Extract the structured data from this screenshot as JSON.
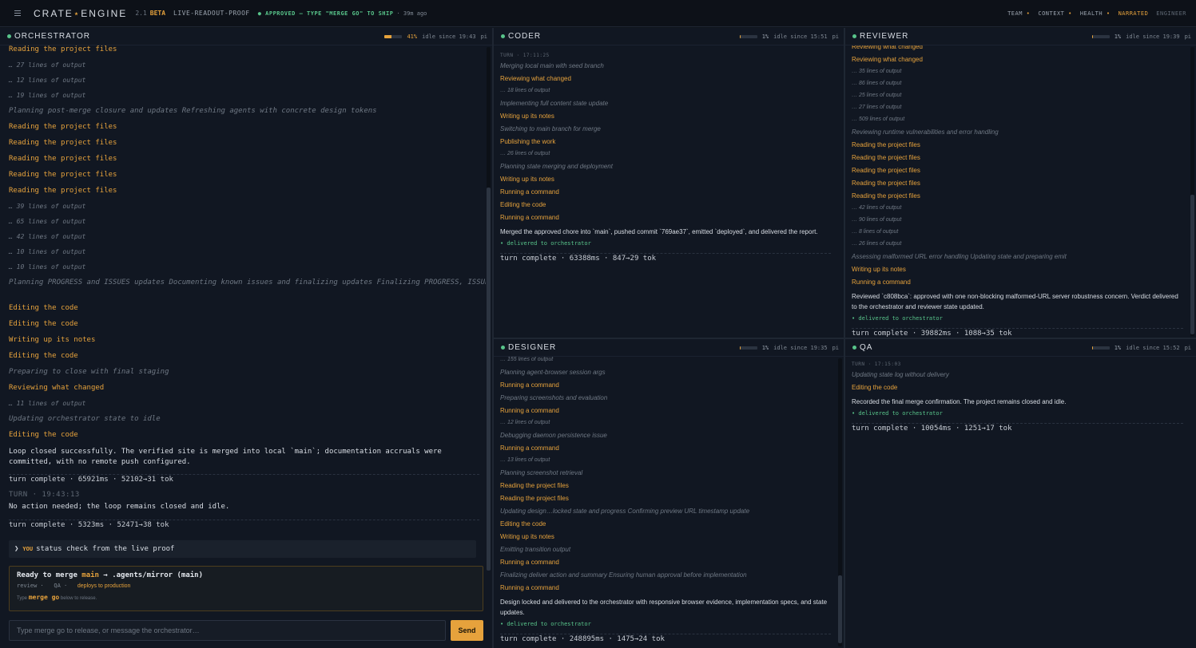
{
  "topbar": {
    "brand_left": "CRATE",
    "brand_star": "⋆",
    "brand_right": "ENGINE",
    "version": "2.1",
    "beta": "BETA",
    "proof": "LIVE-READOUT-PROOF",
    "approved": "● APPROVED — TYPE \"MERGE GO\" TO SHIP",
    "ago": "· 39m ago",
    "nav": {
      "team": "TEAM",
      "context": "CONTEXT",
      "health": "HEALTH",
      "narrated": "NARRATED",
      "engineer": "ENGINEER",
      "dot": "•"
    }
  },
  "panes": {
    "orchestrator": {
      "title": "ORCHESTRATOR",
      "pct": "41%",
      "progress": 0.41,
      "idle": "idle since 19:43",
      "tag": "pi",
      "lines": [
        {
          "t": "act",
          "text": "Reading the project files"
        },
        {
          "t": "out",
          "text": "… 27 lines of output"
        },
        {
          "t": "out",
          "text": "… 12 lines of output"
        },
        {
          "t": "out",
          "text": "… 19 lines of output"
        },
        {
          "t": "think",
          "text": "Planning post-merge closure and updates Refreshing agents with concrete design tokens"
        },
        {
          "t": "act",
          "text": "Reading the project files"
        },
        {
          "t": "act",
          "text": "Reading the project files"
        },
        {
          "t": "act",
          "text": "Reading the project files"
        },
        {
          "t": "act",
          "text": "Reading the project files"
        },
        {
          "t": "act",
          "text": "Reading the project files"
        },
        {
          "t": "out",
          "text": "… 39 lines of output"
        },
        {
          "t": "out",
          "text": "… 65 lines of output"
        },
        {
          "t": "out",
          "text": "… 42 lines of output"
        },
        {
          "t": "out",
          "text": "… 10 lines of output"
        },
        {
          "t": "out",
          "text": "… 10 lines of output"
        },
        {
          "t": "think",
          "text": "Planning PROGRESS and ISSUES updates Documenting known issues and finalizing updates Finalizing PROGRESS, ISSUES, and LESSONS updates"
        },
        {
          "t": "act",
          "text": "Editing the code"
        },
        {
          "t": "act",
          "text": "Editing the code"
        },
        {
          "t": "act",
          "text": "Writing up its notes"
        },
        {
          "t": "act",
          "text": "Editing the code"
        },
        {
          "t": "think",
          "text": "Preparing to close with final staging"
        },
        {
          "t": "act",
          "text": "Reviewing what changed"
        },
        {
          "t": "out",
          "text": "… 11 lines of output"
        },
        {
          "t": "think",
          "text": "Updating orchestrator state to idle"
        },
        {
          "t": "act",
          "text": "Editing the code"
        },
        {
          "t": "result",
          "text": "Loop closed successfully. The verified site is merged into local `main`; documentation accruals were committed, with no remote push configured."
        },
        {
          "t": "turn",
          "text": "turn complete · 65921ms · 52102→31 tok"
        },
        {
          "t": "turnlabel",
          "text": "TURN · 19:43:13"
        },
        {
          "t": "result",
          "text": "No action needed; the loop remains closed and idle."
        },
        {
          "t": "turn",
          "text": "turn complete · 5323ms · 52471→38 tok"
        }
      ],
      "you_chevron": "❯",
      "you_label": "YOU",
      "you_text": "status check from the live proof",
      "merge": {
        "title_pre": "Ready to merge ",
        "title_branch": "main",
        "title_post": " → .agents/mirror (main)",
        "meta_review": "review ·",
        "meta_qa": "QA ·",
        "meta_deploy": "deploys to production",
        "hint_pre": "Type ",
        "hint_cmd": "merge go",
        "hint_post": " below to release."
      },
      "input_placeholder": "Type merge go to release, or message the orchestrator…",
      "send_label": "Send"
    },
    "coder": {
      "title": "CODER",
      "pct": "1%",
      "progress": 0.01,
      "idle": "idle since 15:51",
      "tag": "pi",
      "lines": [
        {
          "t": "turnlabel",
          "text": "TURN · 17:11:25"
        },
        {
          "t": "think",
          "text": "Merging local main with seed branch"
        },
        {
          "t": "act",
          "text": "Reviewing what changed"
        },
        {
          "t": "out",
          "text": "… 18 lines of output"
        },
        {
          "t": "think",
          "text": "Implementing full content state update"
        },
        {
          "t": "act",
          "text": "Writing up its notes"
        },
        {
          "t": "think",
          "text": "Switching to main branch for merge"
        },
        {
          "t": "act",
          "text": "Publishing the work"
        },
        {
          "t": "out",
          "text": "… 26 lines of output"
        },
        {
          "t": "think",
          "text": "Planning state merging and deployment"
        },
        {
          "t": "act",
          "text": "Writing up its notes"
        },
        {
          "t": "act",
          "text": "Running a command"
        },
        {
          "t": "act",
          "text": "Editing the code"
        },
        {
          "t": "act",
          "text": "Running a command"
        },
        {
          "t": "result",
          "text": "Merged the approved chore into `main`, pushed commit `769ae37`, emitted `deployed`, and delivered the report."
        },
        {
          "t": "deliv",
          "text": "• delivered to orchestrator"
        },
        {
          "t": "turn",
          "text": "turn complete · 63388ms · 847→29 tok"
        }
      ]
    },
    "reviewer": {
      "title": "REVIEWER",
      "pct": "1%",
      "progress": 0.01,
      "idle": "idle since 19:39",
      "tag": "pi",
      "lines": [
        {
          "t": "act",
          "text": "Reviewing what changed"
        },
        {
          "t": "act",
          "text": "Reviewing what changed"
        },
        {
          "t": "out",
          "text": "… 35 lines of output"
        },
        {
          "t": "out",
          "text": "… 86 lines of output"
        },
        {
          "t": "out",
          "text": "… 25 lines of output"
        },
        {
          "t": "out",
          "text": "… 27 lines of output"
        },
        {
          "t": "out",
          "text": "… 509 lines of output"
        },
        {
          "t": "think",
          "text": "Reviewing runtime vulnerabilities and error handling"
        },
        {
          "t": "act",
          "text": "Reading the project files"
        },
        {
          "t": "act",
          "text": "Reading the project files"
        },
        {
          "t": "act",
          "text": "Reading the project files"
        },
        {
          "t": "act",
          "text": "Reading the project files"
        },
        {
          "t": "act",
          "text": "Reading the project files"
        },
        {
          "t": "out",
          "text": "… 42 lines of output"
        },
        {
          "t": "out",
          "text": "… 90 lines of output"
        },
        {
          "t": "out",
          "text": "… 8 lines of output"
        },
        {
          "t": "out",
          "text": "… 26 lines of output"
        },
        {
          "t": "think",
          "text": "Assessing malformed URL error handling Updating state and preparing emit"
        },
        {
          "t": "act",
          "text": "Writing up its notes"
        },
        {
          "t": "act",
          "text": "Running a command"
        },
        {
          "t": "result",
          "text": "Reviewed `c808bca`: approved with one non-blocking malformed-URL server robustness concern. Verdict delivered to the orchestrator and reviewer state updated."
        },
        {
          "t": "deliv",
          "text": "• delivered to orchestrator"
        },
        {
          "t": "turn",
          "text": "turn complete · 39882ms · 1088→35 tok"
        }
      ]
    },
    "designer": {
      "title": "DESIGNER",
      "pct": "1%",
      "progress": 0.01,
      "idle": "idle since 19:35",
      "tag": "pi",
      "lines": [
        {
          "t": "out",
          "text": "… 155 lines of output"
        },
        {
          "t": "think",
          "text": "Planning agent-browser session args"
        },
        {
          "t": "act",
          "text": "Running a command"
        },
        {
          "t": "think",
          "text": "Preparing screenshots and evaluation"
        },
        {
          "t": "act",
          "text": "Running a command"
        },
        {
          "t": "out",
          "text": "… 12 lines of output"
        },
        {
          "t": "think",
          "text": "Debugging daemon persistence issue"
        },
        {
          "t": "act",
          "text": "Running a command"
        },
        {
          "t": "out",
          "text": "… 13 lines of output"
        },
        {
          "t": "think",
          "text": "Planning screenshot retrieval"
        },
        {
          "t": "act",
          "text": "Reading the project files"
        },
        {
          "t": "act",
          "text": "Reading the project files"
        },
        {
          "t": "think",
          "text": "Updating design…locked state and progress Confirming preview URL timestamp update"
        },
        {
          "t": "act",
          "text": "Editing the code"
        },
        {
          "t": "act",
          "text": "Writing up its notes"
        },
        {
          "t": "think",
          "text": "Emitting transition output"
        },
        {
          "t": "act",
          "text": "Running a command"
        },
        {
          "t": "think",
          "text": "Finalizing deliver action and summary Ensuring human approval before implementation"
        },
        {
          "t": "act",
          "text": "Running a command"
        },
        {
          "t": "result",
          "text": "Design locked and delivered to the orchestrator with responsive browser evidence, implementation specs, and state updates."
        },
        {
          "t": "deliv",
          "text": "• delivered to orchestrator"
        },
        {
          "t": "turn",
          "text": "turn complete · 248895ms · 1475→24 tok"
        }
      ]
    },
    "qa": {
      "title": "QA",
      "pct": "1%",
      "progress": 0.01,
      "idle": "idle since 15:52",
      "tag": "pi",
      "lines": [
        {
          "t": "turnlabel",
          "text": "TURN · 17:15:03"
        },
        {
          "t": "think",
          "text": "Updating state log without delivery"
        },
        {
          "t": "act",
          "text": "Editing the code"
        },
        {
          "t": "result",
          "text": "Recorded the final merge confirmation. The project remains closed and idle."
        },
        {
          "t": "deliv",
          "text": "• delivered to orchestrator"
        },
        {
          "t": "turn",
          "text": "turn complete · 10054ms · 1251→17 tok"
        }
      ]
    }
  }
}
